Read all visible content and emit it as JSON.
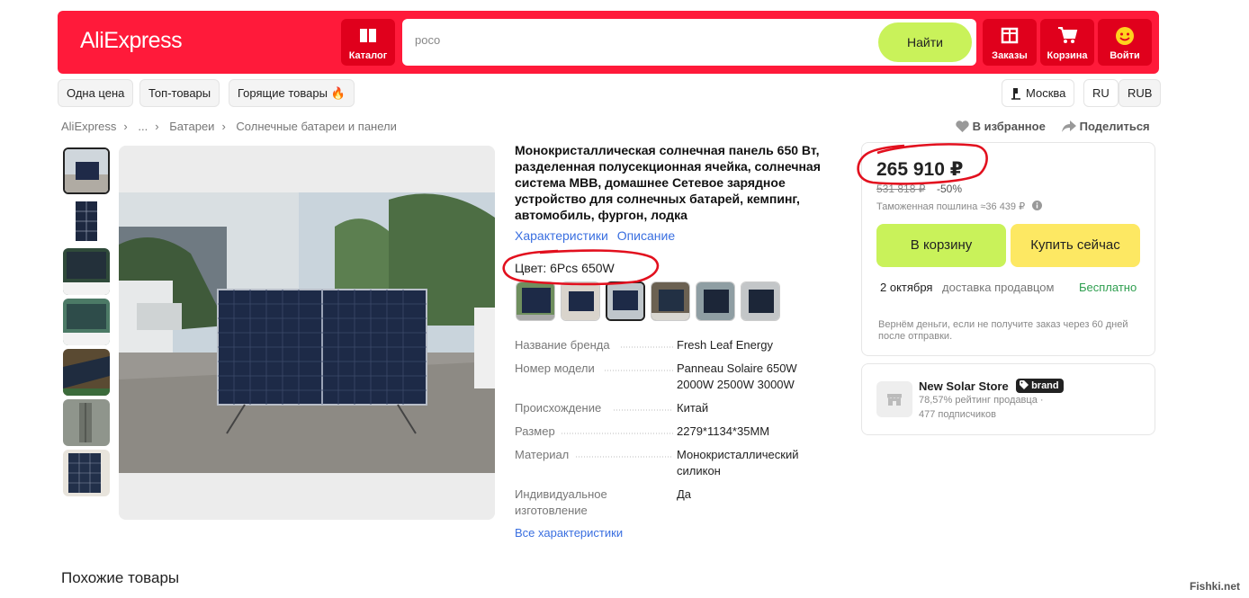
{
  "header": {
    "logo": "AliExpress",
    "catalog": "Каталог",
    "search_value": "poco",
    "search_button": "Найти",
    "orders": "Заказы",
    "cart": "Корзина",
    "login": "Войти"
  },
  "subnav": {
    "one_price": "Одна цена",
    "top": "Топ-товары",
    "hot": "Горящие товары 🔥",
    "city": "Москва",
    "lang": "RU",
    "currency": "RUB"
  },
  "breadcrumb": [
    "AliExpress",
    "...",
    "Батареи",
    "Солнечные батареи и панели"
  ],
  "actions": {
    "favorite": "В избранное",
    "share": "Поделиться"
  },
  "product": {
    "title": "Монокристаллическая солнечная панель 650 Вт, разделенная полусекционная ячейка, солнечная система МВВ, домашнее Сетевое зарядное устройство для солнечных батарей, кемпинг, автомобиль, фургон, лодка",
    "tab_specs": "Характеристики",
    "tab_desc": "Описание",
    "color": "Цвет: 6Pcs 650W",
    "specs": [
      {
        "k": "Название бренда",
        "v": "Fresh Leaf Energy"
      },
      {
        "k": "Номер модели",
        "v": "Panneau Solaire 650W 2000W 2500W 3000W"
      },
      {
        "k": "Происхождение",
        "v": "Китай"
      },
      {
        "k": "Размер",
        "v": "2279*1134*35MM"
      },
      {
        "k": "Материал",
        "v": "Монокристаллический силикон"
      },
      {
        "k": "Индивидуальное изготовление",
        "v": "Да"
      }
    ],
    "all_specs": "Все характеристики"
  },
  "buy": {
    "price": "265 910 ₽",
    "old_price": "531 818 ₽",
    "discount": "-50%",
    "duty": "Таможенная пошлина ≈36 439 ₽",
    "add_cart": "В корзину",
    "buy_now": "Купить сейчас",
    "date": "2 октября",
    "delivery": "доставка продавцом",
    "free": "Бесплатно",
    "refund": "Вернём деньги, если не получите заказ через 60 дней после отправки."
  },
  "store": {
    "name": "New Solar Store",
    "badge": "brand",
    "rating": "78,57% рейтинг продавца ·",
    "subscribers": "477 подписчиков"
  },
  "similar": "Похожие товары",
  "watermark": "Fishki.net",
  "colors": {
    "accent": "#ff1a3a",
    "green": "#c9f25a",
    "yellow": "#fde863",
    "link": "#3a6fe0",
    "annotation": "#e2101e"
  }
}
